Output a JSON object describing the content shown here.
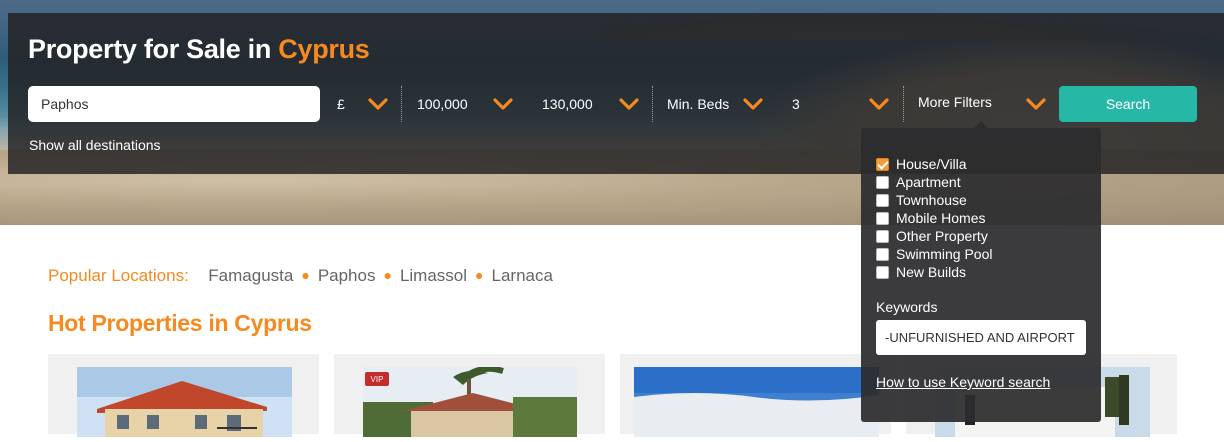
{
  "hero": {
    "title_prefix": "Property for Sale in ",
    "title_accent": "Cyprus"
  },
  "search": {
    "location_value": "Paphos",
    "button_label": "Search",
    "show_all_label": "Show all destinations"
  },
  "filters": {
    "currency": "£",
    "min_price": "100,000",
    "max_price": "130,000",
    "beds_label": "Min. Beds",
    "beds_value": "3",
    "more_filters_label": "More Filters"
  },
  "dropdown": {
    "options": [
      {
        "label": "House/Villa",
        "checked": true
      },
      {
        "label": "Apartment",
        "checked": false
      },
      {
        "label": "Townhouse",
        "checked": false
      },
      {
        "label": "Mobile Homes",
        "checked": false
      },
      {
        "label": "Other Property",
        "checked": false
      },
      {
        "label": "Swimming Pool",
        "checked": false
      },
      {
        "label": "New Builds",
        "checked": false
      }
    ],
    "keywords_label": "Keywords",
    "keywords_value": "-UNFURNISHED AND AIRPORT",
    "keyword_help_link": "How to use Keyword search"
  },
  "popular": {
    "label": "Popular Locations:",
    "locations": [
      "Famagusta",
      "Paphos",
      "Limassol",
      "Larnaca"
    ]
  },
  "hot_properties": {
    "title": "Hot Properties in Cyprus",
    "badge": "VIP"
  },
  "colors": {
    "accent": "#f7891e",
    "search_button": "#27b7a6",
    "overlay": "#222224"
  }
}
